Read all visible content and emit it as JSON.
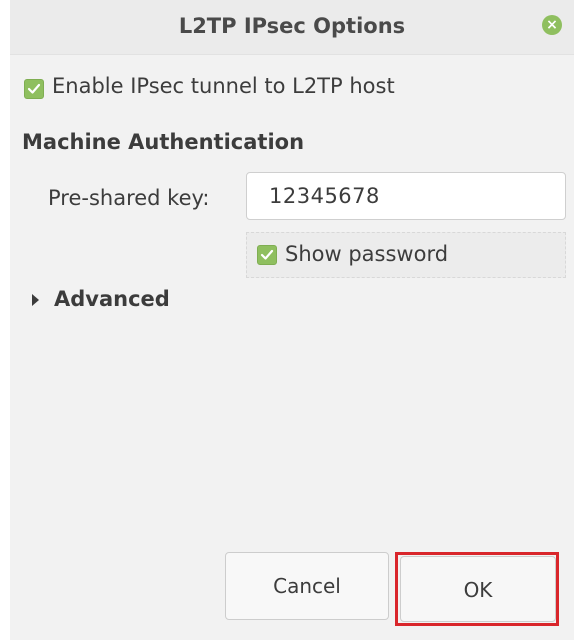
{
  "window": {
    "title": "L2TP IPsec Options"
  },
  "ipsec": {
    "enable_label": "Enable IPsec tunnel to L2TP host",
    "enable_checked": true
  },
  "machine_auth": {
    "heading": "Machine Authentication",
    "psk_label": "Pre-shared key:",
    "psk_value": "12345678",
    "show_password_label": "Show password",
    "show_password_checked": true
  },
  "advanced": {
    "label": "Advanced",
    "expanded": false
  },
  "buttons": {
    "cancel_label": "Cancel",
    "ok_label": "OK"
  },
  "colors": {
    "accent": "#8fbf5f",
    "highlight": "#d9262b"
  }
}
